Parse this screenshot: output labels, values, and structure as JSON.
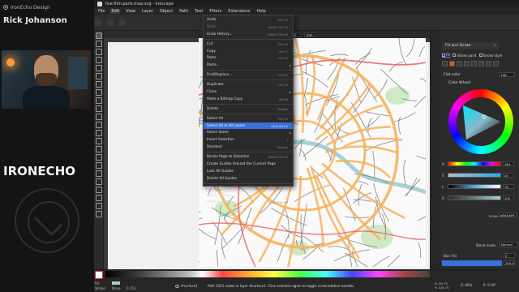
{
  "presenter": {
    "brand": "IronEcho Design",
    "name": "Rick Johanson",
    "logo_text": "IRONECHO"
  },
  "app": {
    "title": "live.film.paris.map.svg - Inkscape",
    "menu": [
      "File",
      "Edit",
      "View",
      "Layer",
      "Object",
      "Path",
      "Text",
      "Filters",
      "Extensions",
      "Help"
    ],
    "active_menu": "Edit"
  },
  "controls": {
    "x_label": "X",
    "x_value": "45.306",
    "y_label": "Y",
    "y_value": "136.211",
    "w_label": "W",
    "w_value": "22.972",
    "h_label": "H",
    "h_value": "15.882",
    "unit": "mm"
  },
  "edit_menu": {
    "items": [
      {
        "label": "Undo",
        "shortcut": "Ctrl+Z",
        "disabled": false
      },
      {
        "label": "Redo",
        "shortcut": "Shift+Ctrl+Z",
        "disabled": true
      },
      {
        "label": "Undo History...",
        "shortcut": "Shift+Ctrl+H",
        "disabled": false
      },
      {
        "sep": true
      },
      {
        "label": "Cut",
        "shortcut": "Ctrl+X",
        "disabled": false
      },
      {
        "label": "Copy",
        "shortcut": "Ctrl+C",
        "disabled": false
      },
      {
        "label": "Paste",
        "shortcut": "Ctrl+V",
        "disabled": false
      },
      {
        "label": "Paste...",
        "shortcut": "",
        "submenu": true,
        "disabled": false
      },
      {
        "sep": true
      },
      {
        "label": "Find/Replace...",
        "shortcut": "Ctrl+F",
        "disabled": false
      },
      {
        "sep": true
      },
      {
        "label": "Duplicate",
        "shortcut": "Ctrl+D",
        "disabled": false
      },
      {
        "label": "Clone",
        "shortcut": "",
        "submenu": true,
        "disabled": false
      },
      {
        "label": "Make a Bitmap Copy",
        "shortcut": "Alt+B",
        "disabled": false
      },
      {
        "sep": true
      },
      {
        "label": "Delete",
        "shortcut": "Delete",
        "disabled": false
      },
      {
        "sep": true
      },
      {
        "label": "Select All",
        "shortcut": "Ctrl+A",
        "disabled": false
      },
      {
        "label": "Select All in All Layers",
        "shortcut": "Ctrl+Alt+A",
        "disabled": false,
        "highlight": true
      },
      {
        "label": "Select Same",
        "shortcut": "",
        "submenu": true,
        "disabled": false
      },
      {
        "label": "Invert Selection",
        "shortcut": "!",
        "disabled": false
      },
      {
        "label": "Deselect",
        "shortcut": "Escape",
        "disabled": false
      },
      {
        "sep": true
      },
      {
        "label": "Resize Page to Selection",
        "shortcut": "Shift+Ctrl+R",
        "disabled": false
      },
      {
        "label": "Create Guides Around the Current Page",
        "shortcut": "",
        "disabled": false
      },
      {
        "label": "Lock All Guides",
        "shortcut": "",
        "disabled": false
      },
      {
        "label": "Delete All Guides",
        "shortcut": "",
        "disabled": false
      },
      {
        "sep": true
      },
      {
        "label": "XML Editor...",
        "shortcut": "Shift+Ctrl+X",
        "disabled": false
      },
      {
        "label": "Input Devices...",
        "shortcut": "",
        "disabled": false
      },
      {
        "label": "Preferences",
        "shortcut": "Shift+Ctrl+P",
        "disabled": false
      }
    ]
  },
  "dock": {
    "panel_title": "Fill and Stroke",
    "tabs": [
      "Fill",
      "Stroke paint",
      "Stroke style"
    ],
    "flat_color_label": "Flat color",
    "color_mode": "HSL",
    "color_wheel_label": "Color Wheel",
    "sliders": [
      {
        "label": "H",
        "value": "184"
      },
      {
        "label": "S",
        "value": "45"
      },
      {
        "label": "L",
        "value": "76"
      },
      {
        "label": "A",
        "value": "100"
      }
    ],
    "rgba_label": "RGBA:",
    "rgba_value": "a8d1d4ff",
    "blend_label": "Blend mode",
    "blend_value": "Normal",
    "blur_label": "Blur (%)",
    "blur_value": "0",
    "opacity_label": "Opacity (%)",
    "opacity_value": "100.0"
  },
  "status": {
    "fill_label": "Fill:",
    "stroke_label": "Stroke:",
    "stroke_value": "None",
    "stroke_width": "0.353",
    "layer_name": "#surface1",
    "message": "Path 1201 nodes in layer #surface1. Click selection again to toggle scale/rotation handles.",
    "x_coord": "X: 50.75",
    "y_coord": "Y: 116.75",
    "zoom": "Z: 60%",
    "rotation": "R: 0.00°"
  },
  "colors": {
    "accent": "#3a6fd8",
    "road_major": "#f6b25a",
    "road_highlight": "#e8606a",
    "road_minor": "#777777",
    "water": "#a8d1d4",
    "park": "#c7e3b8"
  }
}
